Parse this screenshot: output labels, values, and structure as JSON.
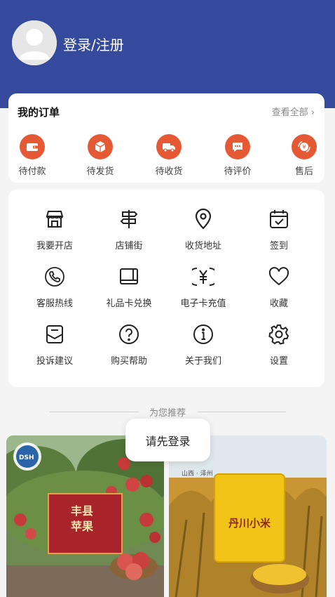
{
  "header": {
    "login_text": "登录/注册"
  },
  "orders": {
    "title": "我的订单",
    "view_all": "查看全部",
    "items": [
      {
        "label": "待付款",
        "icon": "wallet-icon"
      },
      {
        "label": "待发货",
        "icon": "box-icon"
      },
      {
        "label": "待收货",
        "icon": "truck-icon"
      },
      {
        "label": "待评价",
        "icon": "comment-icon"
      },
      {
        "label": "售后",
        "icon": "yen-refund-icon"
      }
    ]
  },
  "services": {
    "items": [
      {
        "label": "我要开店",
        "icon": "store-icon"
      },
      {
        "label": "店铺街",
        "icon": "signpost-icon"
      },
      {
        "label": "收货地址",
        "icon": "location-icon"
      },
      {
        "label": "签到",
        "icon": "calendar-check-icon"
      },
      {
        "label": "客服热线",
        "icon": "phone-icon"
      },
      {
        "label": "礼品卡兑换",
        "icon": "gift-card-icon"
      },
      {
        "label": "电子卡充值",
        "icon": "yen-card-icon"
      },
      {
        "label": "收藏",
        "icon": "heart-icon"
      },
      {
        "label": "投诉建议",
        "icon": "mail-icon"
      },
      {
        "label": "购买帮助",
        "icon": "question-icon"
      },
      {
        "label": "关于我们",
        "icon": "info-icon"
      },
      {
        "label": "设置",
        "icon": "gear-icon"
      }
    ]
  },
  "recommend": {
    "title": "为您推荐"
  },
  "products": [
    {
      "name": "丰县苹果",
      "logo_text": "DSH"
    },
    {
      "name": "丹川小米",
      "region": "山西 · 泽州"
    }
  ],
  "toast": {
    "text": "请先登录"
  },
  "colors": {
    "header_bg": "#354a9c",
    "accent": "#e55a35"
  }
}
